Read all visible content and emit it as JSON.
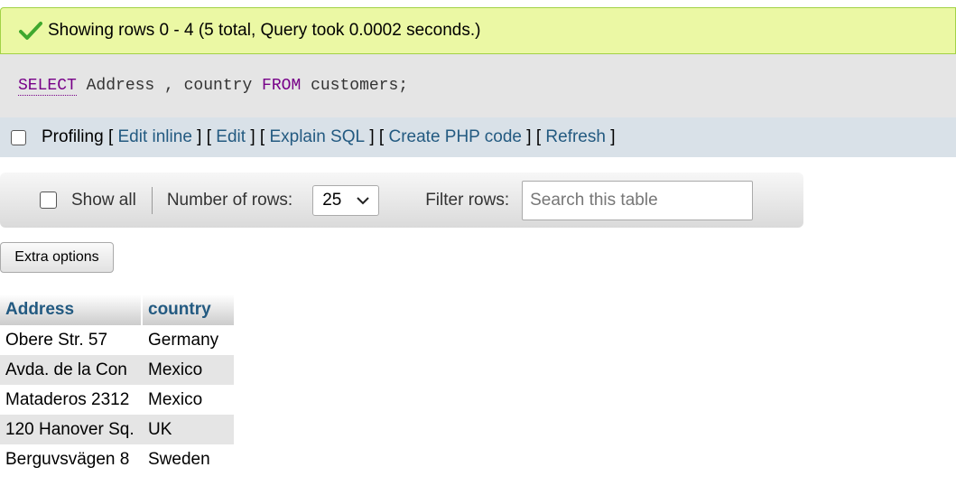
{
  "success": {
    "message": "Showing rows 0 - 4 (5 total, Query took 0.0002 seconds.)",
    "icon": "check-icon"
  },
  "sql": {
    "select": "SELECT",
    "cols": " Address , country ",
    "from": "FROM",
    "table": " customers;"
  },
  "profiling": {
    "label": "Profiling",
    "open_bracket": "[",
    "sep": "] [",
    "close_bracket": "]",
    "edit_inline": "Edit inline",
    "edit": "Edit",
    "explain_sql": "Explain SQL",
    "create_php": "Create PHP code",
    "refresh": "Refresh"
  },
  "nav": {
    "show_all": "Show all",
    "number_of_rows": "Number of rows:",
    "rows_value": "25",
    "filter_rows": "Filter rows:",
    "search_placeholder": "Search this table"
  },
  "extra_options": "Extra options",
  "table": {
    "headers": [
      "Address",
      "country"
    ],
    "rows": [
      [
        "Obere Str. 57",
        "Germany"
      ],
      [
        "Avda. de la Con",
        "Mexico"
      ],
      [
        "Mataderos 2312",
        "Mexico"
      ],
      [
        "120 Hanover Sq.",
        "UK"
      ],
      [
        "Berguvsvägen 8",
        "Sweden"
      ]
    ]
  },
  "colors": {
    "success_bg": "#ebf8a4",
    "link": "#235a81",
    "keyword": "#770088"
  }
}
